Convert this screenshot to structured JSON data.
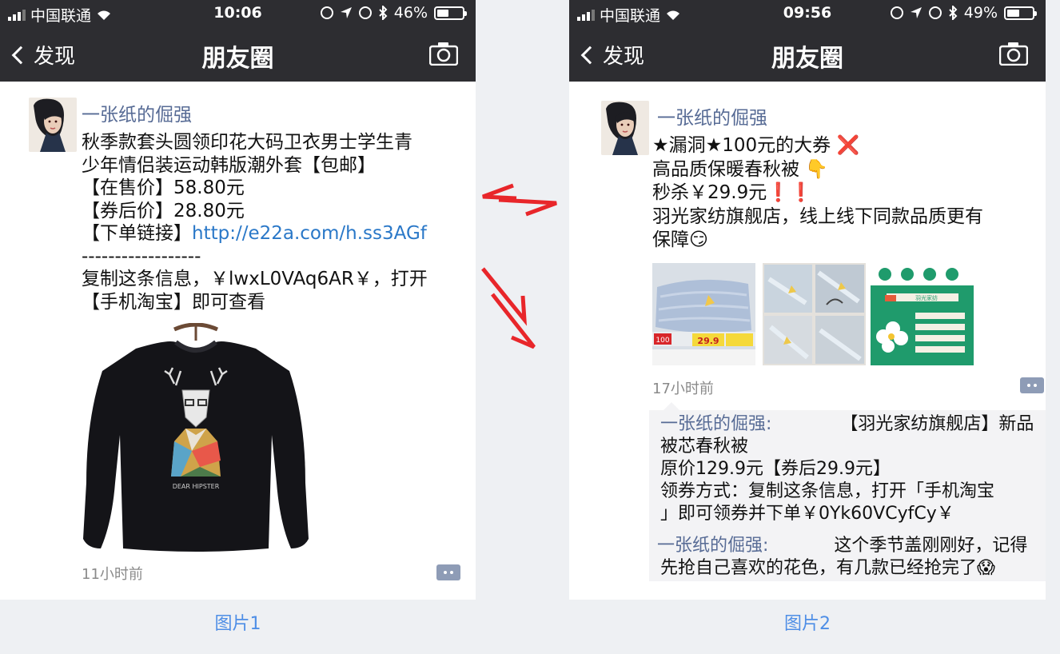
{
  "left": {
    "status": {
      "carrier": "中国联通",
      "time": "10:06",
      "battery": "46%",
      "battery_level": 0.46
    },
    "nav": {
      "back": "发现",
      "title": "朋友圈"
    },
    "post": {
      "author": "一张纸的倔强",
      "lines": [
        "秋季款套头圆领印花大码卫衣男士学生青",
        "少年情侣装运动韩版潮外套【包邮】",
        "【在售价】58.80元",
        "【券后价】28.80元"
      ],
      "link_prefix": "【下单链接】",
      "link": "http://e22a.com/h.ss3AGf",
      "divider": "------------------",
      "lines2": [
        "复制这条信息，￥lwxL0VAq6AR￥，打开",
        "【手机淘宝】即可查看"
      ],
      "sweater_print": "DEAR HIPSTER",
      "time": "11小时前"
    },
    "caption": "图片1"
  },
  "right": {
    "status": {
      "carrier": "中国联通",
      "time": "09:56",
      "battery": "49%",
      "battery_level": 0.49
    },
    "nav": {
      "back": "发现",
      "title": "朋友圈"
    },
    "post": {
      "author": "一张纸的倔强",
      "lines": [
        "★漏洞★100元的大券 ❌",
        "高品质保暖春秋被 👇",
        "秒杀￥29.9元❗❗",
        "羽光家纺旗舰店，线上线下同款品质更有",
        "保障😏"
      ],
      "thumb1_price": "29.9",
      "thumb1_badge": "100",
      "thumb3_title": "羽光家纺",
      "time": "17小时前"
    },
    "comments": [
      {
        "name": "一张纸的倔强:",
        "lines": [
          "【羽光家纺旗舰店】新品",
          "被芯春秋被",
          "原价129.9元【券后29.9元】",
          "领券方式：复制这条信息，打开「手机淘宝",
          "」即可领券并下单￥0Yk60VCyfCy￥"
        ]
      },
      {
        "name": "一张纸的倔强:",
        "lines": [
          "这个季节盖刚刚好，记得",
          "先抢自己喜欢的花色，有几款已经抢完了😱"
        ]
      }
    ],
    "caption": "图片2"
  },
  "colors": {
    "nav_bg": "#2d2d31",
    "link_blue": "#576b95",
    "url_blue": "#2a78c8",
    "caption_blue": "#4e8ee6",
    "arrow_red": "#e8262a"
  }
}
